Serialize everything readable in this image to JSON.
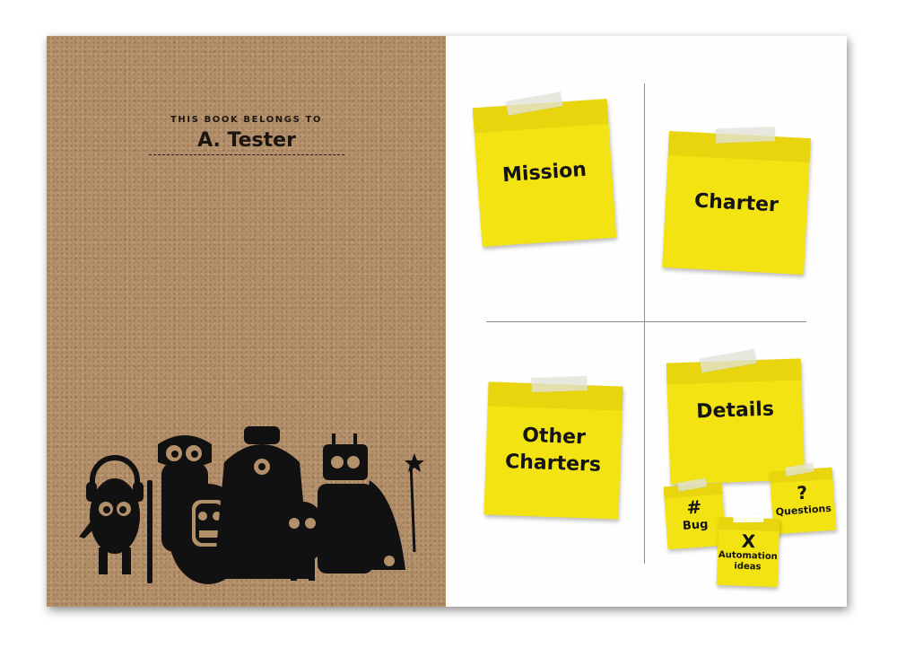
{
  "cover": {
    "belongs_label": "THIS BOOK BELONGS TO",
    "owner_name": "A. Tester"
  },
  "notes": {
    "mission": "Mission",
    "charter": "Charter",
    "other_line1": "Other",
    "other_line2": "Charters",
    "details": "Details",
    "bug_symbol": "#",
    "bug_label": "Bug",
    "automation_symbol": "X",
    "automation_line1": "Automation",
    "automation_line2": "ideas",
    "questions_symbol": "?",
    "questions_label": "Questions"
  },
  "colors": {
    "kraft": "#b38f6a",
    "note_yellow": "#f4e312",
    "ink": "#141414"
  }
}
